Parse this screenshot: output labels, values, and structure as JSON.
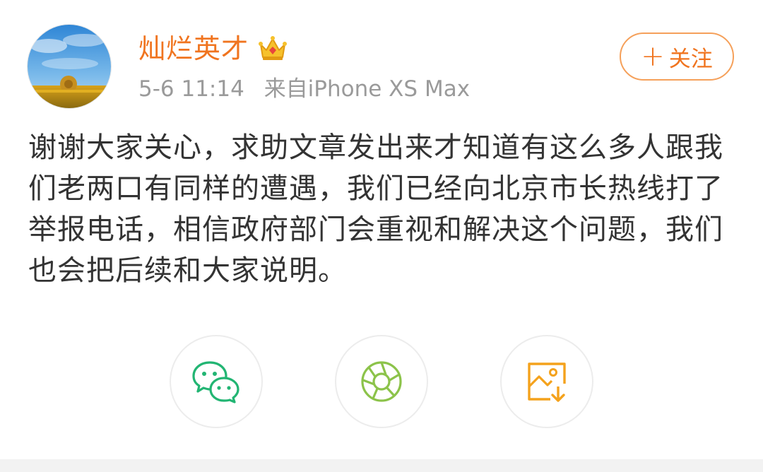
{
  "post": {
    "author": {
      "name": "灿烂英才",
      "avatar_icon": "avatar-sunflower-field-icon",
      "badge_icon": "vip-crown-icon"
    },
    "time": "5-6 11:14",
    "source": "来自iPhone XS Max",
    "follow_button": {
      "plus": "+",
      "label": "关注"
    },
    "text": "谢谢大家关心，求助文章发出来才知道有这么多人跟我们老两口有同样的遭遇，我们已经向北京市长热线打了举报电话，相信政府部门会重视和解决这个问题，我们也会把后续和大家说明。"
  },
  "share": {
    "buttons": [
      {
        "icon": "wechat-icon",
        "color": "#22b573"
      },
      {
        "icon": "moments-icon",
        "color": "#8cc34a"
      },
      {
        "icon": "save-image-icon",
        "color": "#f4a21c"
      }
    ]
  },
  "colors": {
    "accent": "#f0741f",
    "meta_text": "#9a9a9a",
    "body_text": "#333333"
  }
}
